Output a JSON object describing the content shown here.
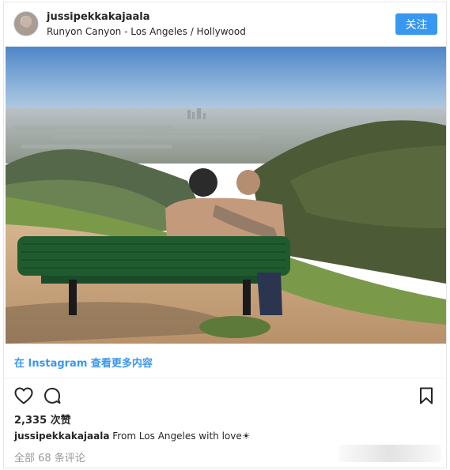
{
  "header": {
    "username": "jussipekkakajaala",
    "location": "Runyon Canyon - Los Angeles / Hollywood",
    "follow_label": "关注"
  },
  "link_row": {
    "text": "在 Instagram 查看更多内容"
  },
  "actions": {
    "like_icon": "heart-icon",
    "comment_icon": "comment-icon",
    "save_icon": "bookmark-icon"
  },
  "likes": "2,335 次赞",
  "caption": {
    "username": "jussipekkakajaala",
    "text": "From Los Angeles with love☀"
  },
  "comments_link": "全部 68 条评论",
  "colors": {
    "accent": "#3897f0",
    "text": "#262626",
    "muted": "#999999"
  }
}
